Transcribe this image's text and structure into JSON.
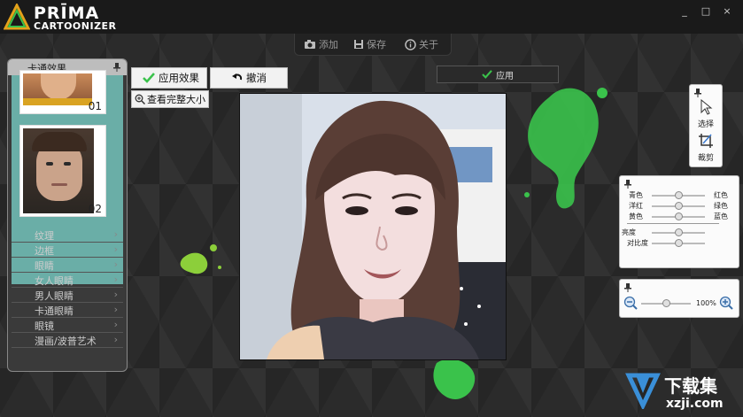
{
  "app": {
    "logo_line1": "PRĪMA",
    "logo_line2": "CARTOONIZER",
    "colors": {
      "accent_green": "#3ac24b",
      "panel_teal": "#6aaea7",
      "bg": "#2b2b2b"
    }
  },
  "window": {
    "minimize": "_",
    "maximize": "□",
    "close": "×"
  },
  "toolbar": {
    "add_label": "添加",
    "save_label": "保存",
    "about_label": "关于"
  },
  "left_panel": {
    "header": "卡通效果",
    "thumbs": [
      {
        "num": "01"
      },
      {
        "num": "02"
      }
    ],
    "items": [
      {
        "label": "纹理"
      },
      {
        "label": "边框"
      },
      {
        "label": "眼睛"
      },
      {
        "label": "女人眼睛"
      },
      {
        "label": "男人眼睛"
      },
      {
        "label": "卡通眼睛"
      },
      {
        "label": "眼镜"
      },
      {
        "label": "漫画/波普艺术"
      }
    ],
    "chevron": "›"
  },
  "actions": {
    "apply_effect": "应用效果",
    "undo": "撤消",
    "view_full": "查看完整大小",
    "apply_top": "应用"
  },
  "tools": {
    "select": "选择",
    "crop": "裁剪"
  },
  "color_panel": {
    "rows": [
      {
        "left": "青色",
        "right": "红色",
        "value": 0.5
      },
      {
        "left": "洋红",
        "right": "绿色",
        "value": 0.5
      },
      {
        "left": "黄色",
        "right": "蓝色",
        "value": 0.5
      }
    ],
    "brightness": {
      "label": "亮度",
      "value": 0.5
    },
    "contrast": {
      "label": "对比度",
      "value": 0.5
    }
  },
  "zoom": {
    "level": "100%",
    "value": 0.5
  },
  "watermark": {
    "brand": "下载集",
    "site": "xzji.com"
  }
}
